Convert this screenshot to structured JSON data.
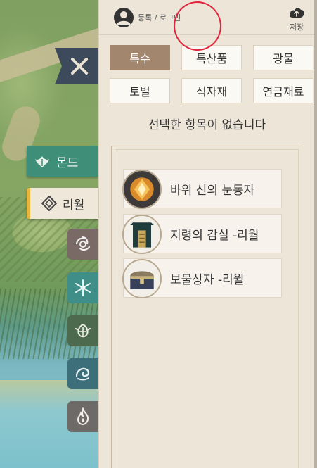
{
  "header": {
    "login_text": "등록 / 로그인",
    "save_label": "저장"
  },
  "regions": {
    "mondstadt": "몬드",
    "liyue": "리월"
  },
  "categories": [
    {
      "label": "특수",
      "active": true
    },
    {
      "label": "특산품",
      "active": false
    },
    {
      "label": "광물",
      "active": false
    },
    {
      "label": "토벌",
      "active": false
    },
    {
      "label": "식자재",
      "active": false
    },
    {
      "label": "연금재료",
      "active": false
    }
  ],
  "status_text": "선택한 항목이 없습니다",
  "items": [
    {
      "label": "바위 신의 눈동자",
      "icon": "geoculus-icon"
    },
    {
      "label": "지령의 감실 -리월",
      "icon": "shrine-icon"
    },
    {
      "label": "보물상자 -리월",
      "icon": "chest-icon"
    }
  ],
  "element_filters": [
    "electro-icon",
    "cryo-icon",
    "dendro-icon",
    "hydro-icon",
    "pyro-icon"
  ],
  "colors": {
    "active_category": "#a2866e",
    "mondstadt_tab": "#3f8f78",
    "liyue_accent": "#e8b63c",
    "annotation": "#e0243c"
  }
}
